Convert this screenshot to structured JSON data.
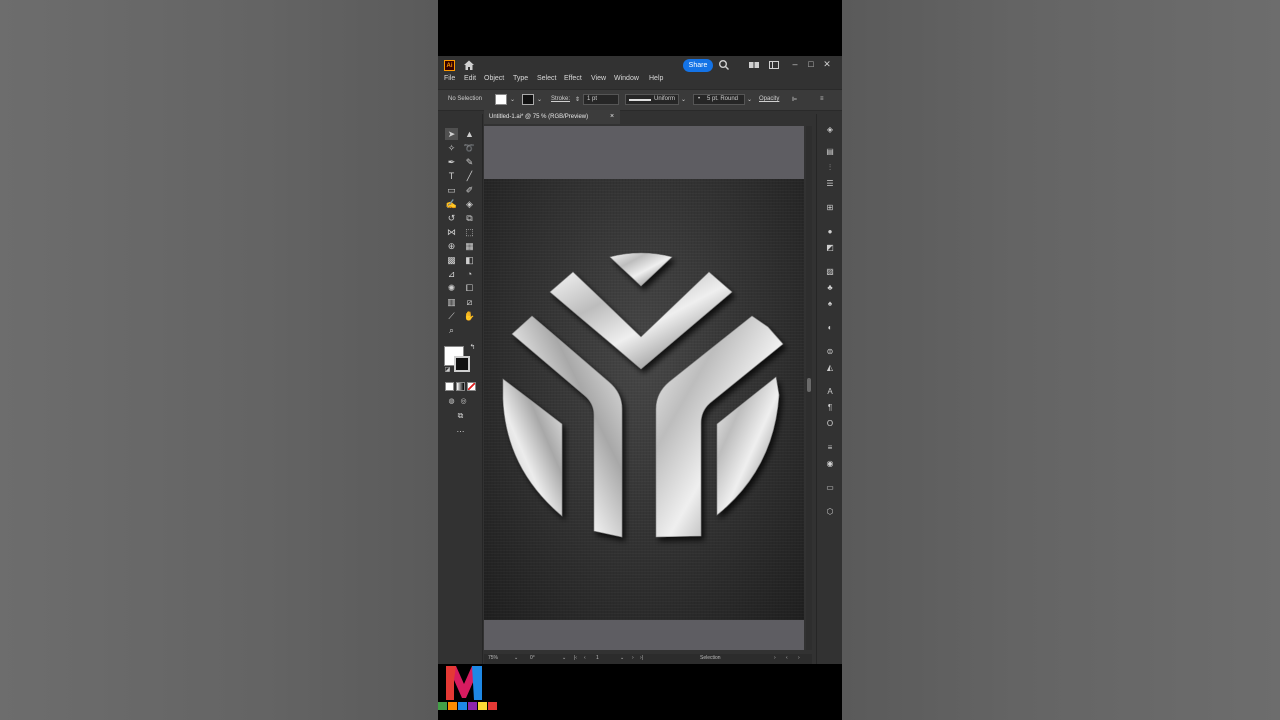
{
  "app": {
    "logo_text": "Ai",
    "share_label": "Share",
    "menu": [
      "File",
      "Edit",
      "Object",
      "Type",
      "Select",
      "Effect",
      "View",
      "Window",
      "Help"
    ]
  },
  "control_bar": {
    "selection_text": "No Selection",
    "stroke_label": "Stroke:",
    "stroke_weight": "1 pt",
    "stroke_profile": "Uniform",
    "brush_label": "5 pt. Round",
    "opacity_label": "Opacity"
  },
  "document": {
    "tab_title": "Untitled-1.ai* @ 75 % (RGB/Preview)",
    "tab_close": "×"
  },
  "status_bar": {
    "zoom": "75%",
    "rotation": "0°",
    "artboard_number": "1",
    "tool_name": "Selection"
  },
  "colors": {
    "accent": "#1473e6",
    "chrome": "#323232",
    "canvas_bg": "#5e5d62"
  },
  "watermark": {
    "letter": "M"
  }
}
